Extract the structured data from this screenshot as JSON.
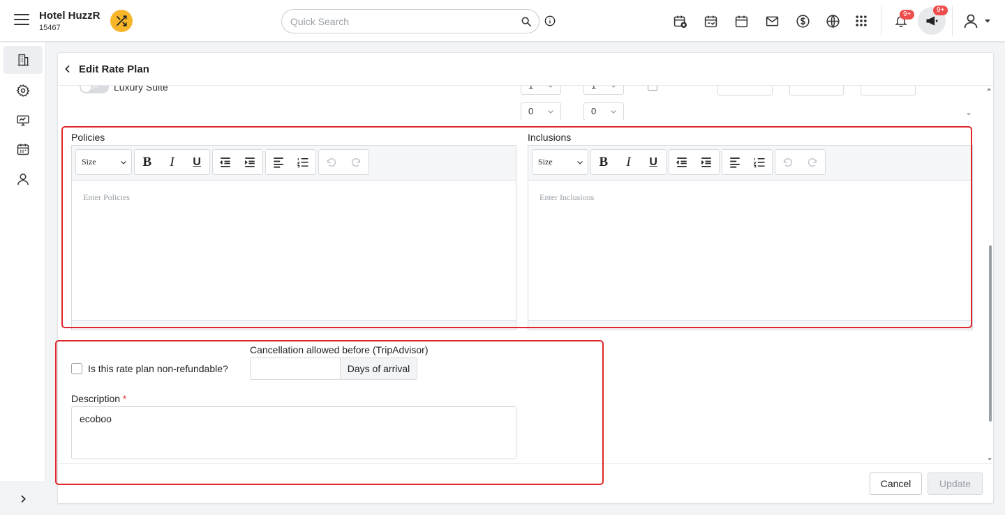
{
  "header": {
    "hotel_name": "Hotel HuzzR",
    "hotel_id": "15467",
    "search_placeholder": "Quick Search",
    "notification_badge": "9+",
    "announcement_badge": "9+"
  },
  "page": {
    "title": "Edit Rate Plan"
  },
  "room_row": {
    "toggle_label": "Off",
    "room_name": "Luxury Suite",
    "select_top_1": "1",
    "select_top_2": "1",
    "select_bottom_1": "0",
    "select_bottom_2": "0"
  },
  "policies": {
    "label": "Policies",
    "placeholder": "Enter Policies",
    "size_label": "Size"
  },
  "inclusions": {
    "label": "Inclusions",
    "placeholder": "Enter Inclusions",
    "size_label": "Size"
  },
  "refund": {
    "checkbox_label": "Is this rate plan non-refundable?",
    "cancellation_label": "Cancellation allowed before (TripAdvisor)",
    "days_addon": "Days of arrival"
  },
  "description": {
    "label": "Description",
    "required_mark": "*",
    "value": "ecoboo"
  },
  "actions": {
    "cancel": "Cancel",
    "update": "Update"
  },
  "colors": {
    "accent_yellow": "#f7b529",
    "highlight_red": "#e0262b",
    "badge_red": "#ef4c4c"
  }
}
